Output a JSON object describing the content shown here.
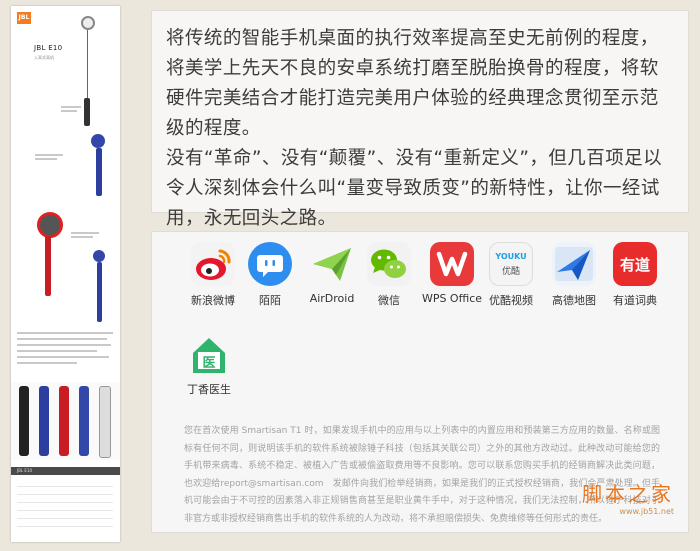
{
  "product_strip": {
    "logo": "JBL",
    "title": "JBL E10",
    "subtitle": "入耳式耳机"
  },
  "description": {
    "paragraph1": "将传统的智能手机桌面的执行效率提高至史无前例的程度，将美学上先天不良的安卓系统打磨至脱胎换骨的程度，将软硬件完美结合才能打造完美用户体验的经典理念贯彻至示范级的程度。",
    "paragraph2": "没有“革命”、没有“颠覆”、没有“重新定义”，但几百项足以令人深刻体会什么叫“量变导致质变”的新特性，让你一经试用，永无回头之路。"
  },
  "apps": [
    {
      "label": "新浪微博",
      "icon": "weibo-icon"
    },
    {
      "label": "陌陌",
      "icon": "momo-icon"
    },
    {
      "label": "AirDroid",
      "icon": "airdroid-icon"
    },
    {
      "label": "微信",
      "icon": "wechat-icon"
    },
    {
      "label": "WPS Office",
      "icon": "wps-icon"
    },
    {
      "label": "优酷视频",
      "icon": "youku-icon",
      "icon_text": "YOUKU",
      "icon_sub": "优酷"
    },
    {
      "label": "高德地图",
      "icon": "amap-icon"
    },
    {
      "label": "有道词典",
      "icon": "youdao-icon",
      "icon_text": "有道"
    },
    {
      "label": "丁香医生",
      "icon": "dxy-icon",
      "icon_text": "医"
    }
  ],
  "legal": "您在首次使用 Smartisan T1 时，如果发现手机中的应用与以上列表中的内置应用和预装第三方应用的数量、名称或图标有任何不同，则说明该手机的软件系统被除锤子科技（包括其关联公司）之外的其他方改动过。此种改动可能给您的手机带来病毒、系统不稳定、被植入广告或被偷盗取费用等不良影响。您可以联系您购买手机的经销商解决此类问题，也欢迎给report@smartisan.com　发邮件向我们检举经销商，如果是我们的正式授权经销商，我们会严肃处理。但手机可能会由于不可控的因素落入非正规销售商甚至是职业黄牛手中，对于这种情况，我们无法控制，所以锤子科技对于非官方或非授权经销商售出手机的软件系统的人为改动，将不承担赔偿损失、免费维修等任何形式的责任。",
  "watermark": {
    "line1": "脚本之家",
    "line2": "www.jb51.net"
  },
  "colors": {
    "background": "#ece7dd",
    "card": "#f7f6f4",
    "text": "#3c3c3c",
    "legal_text": "#a3a3a3",
    "watermark": "#e87722"
  }
}
